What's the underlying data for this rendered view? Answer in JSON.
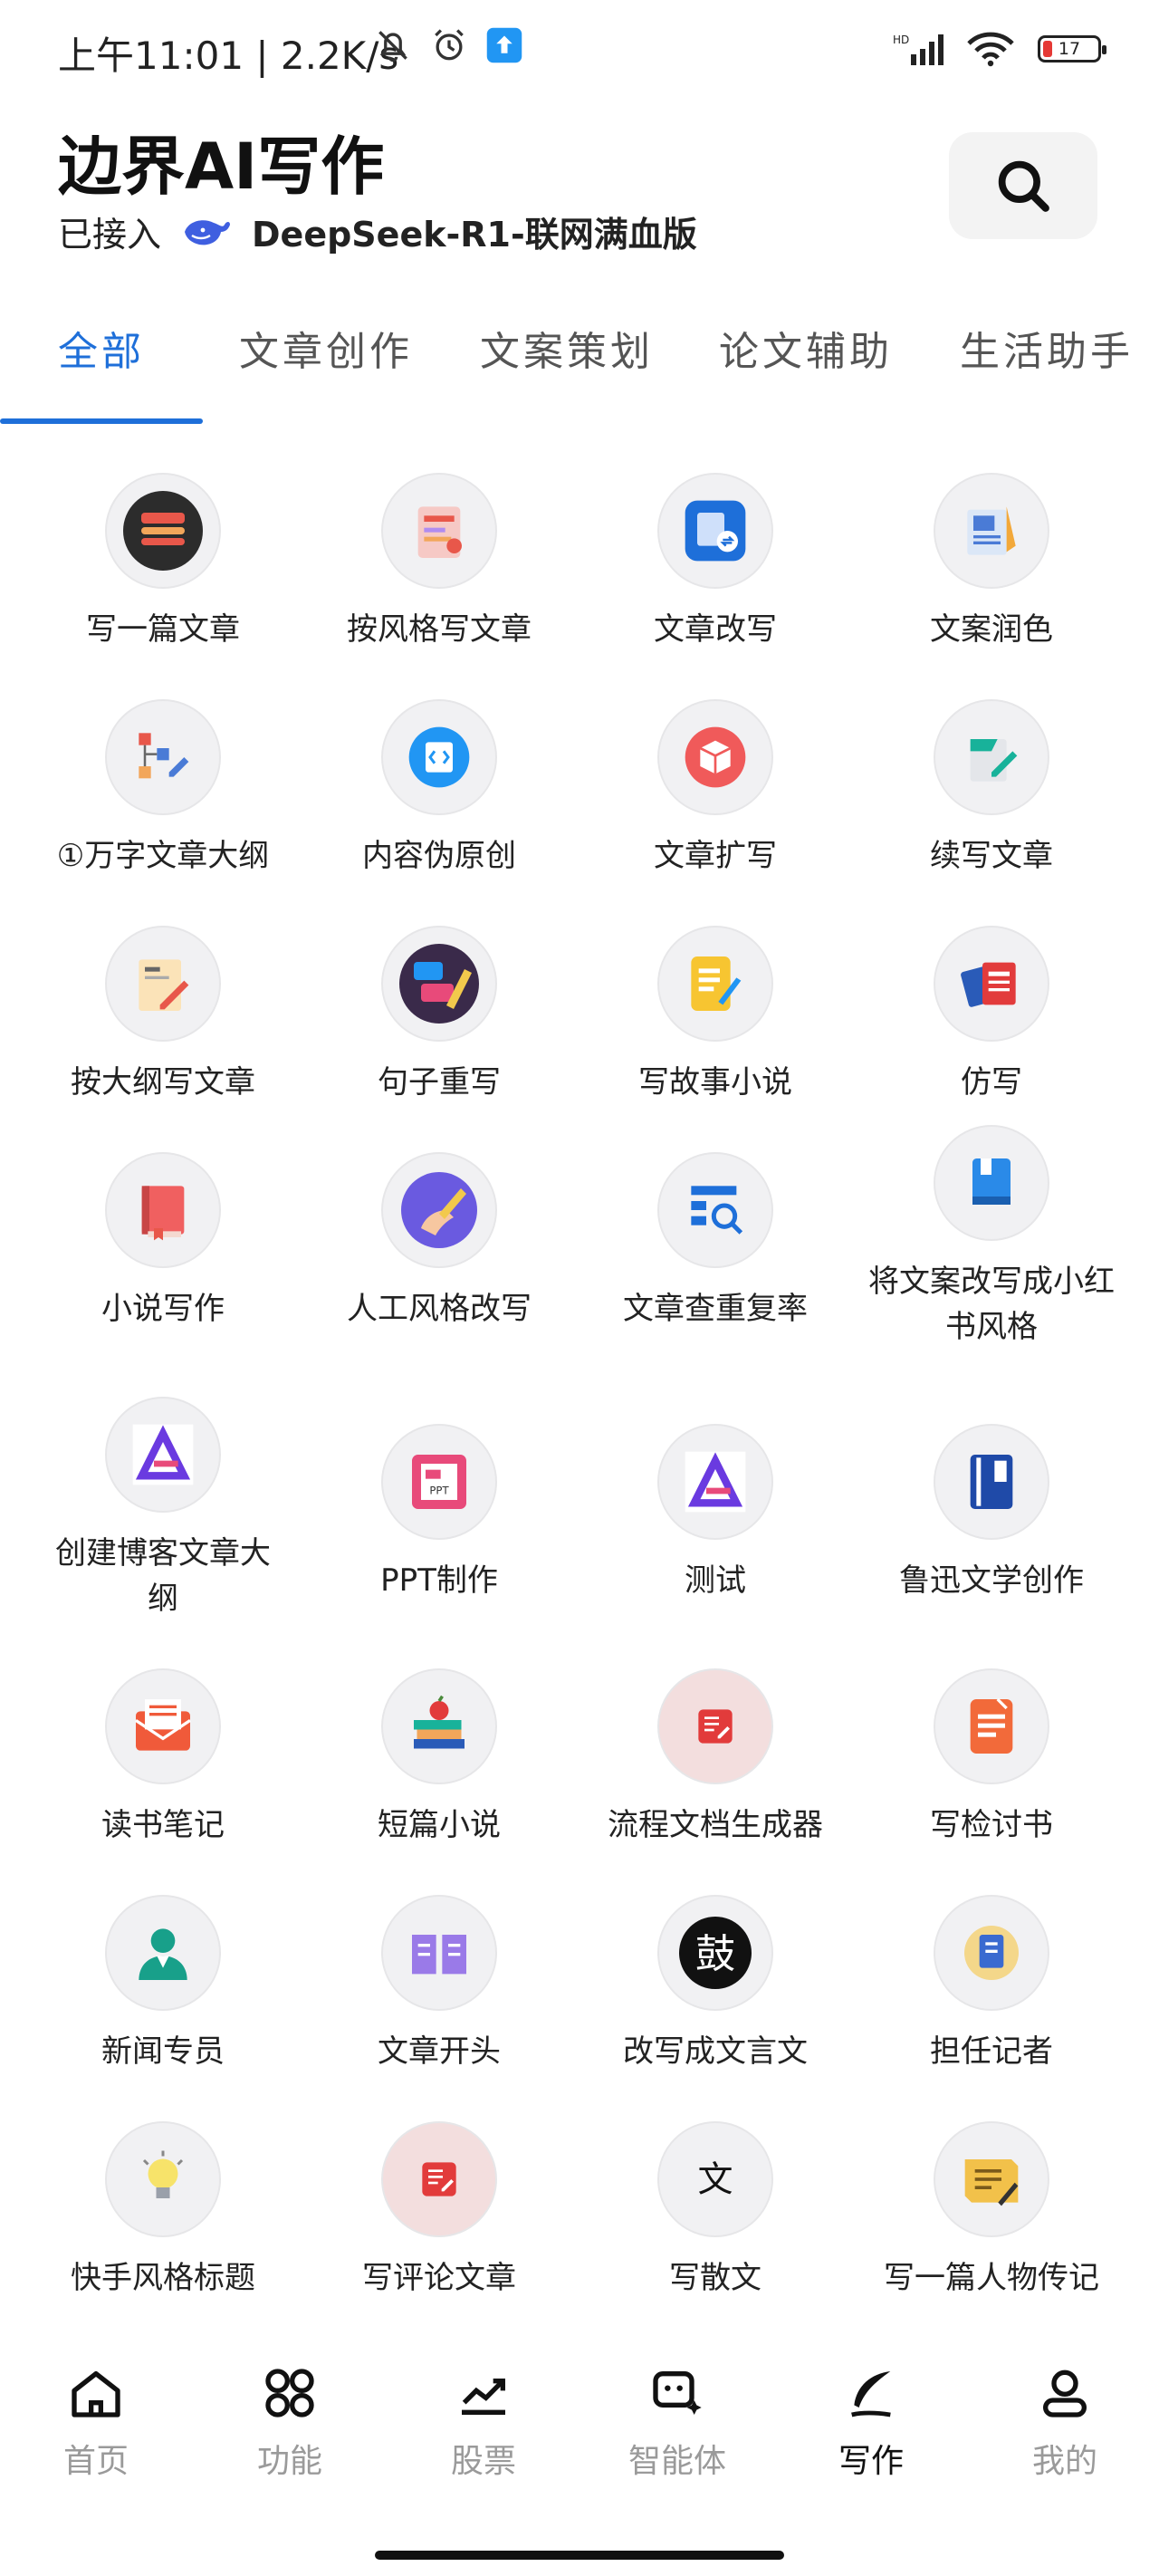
{
  "status": {
    "time": "上午11:01 | 2.2K/s",
    "battery": "17",
    "net": "HD"
  },
  "header": {
    "title": "边界AI写作",
    "connected_prefix": "已接入",
    "model": "DeepSeek-R1-联网满血版"
  },
  "tabs": [
    "全部",
    "文章创作",
    "文案策划",
    "论文辅助",
    "生活助手"
  ],
  "grid": [
    "写一篇文章",
    "按风格写文章",
    "文章改写",
    "文案润色",
    "①万字文章大纲",
    "内容伪原创",
    "文章扩写",
    "续写文章",
    "按大纲写文章",
    "句子重写",
    "写故事小说",
    "仿写",
    "小说写作",
    "人工风格改写",
    "文章查重复率",
    "将文案改写成小红书风格",
    "创建博客文章大纲",
    "PPT制作",
    "测试",
    "鲁迅文学创作",
    "读书笔记",
    "短篇小说",
    "流程文档生成器",
    "写检讨书",
    "新闻专员",
    "文章开头",
    "改写成文言文",
    "担任记者",
    "快手风格标题",
    "写评论文章",
    "写散文",
    "写一篇人物传记"
  ],
  "icon_glyphs": {
    "ppt": "PPT",
    "classical": "鼓",
    "prose": "文"
  },
  "nav": [
    "首页",
    "功能",
    "股票",
    "智能体",
    "写作",
    "我的"
  ],
  "colors": {
    "accent": "#1e6fd9"
  }
}
